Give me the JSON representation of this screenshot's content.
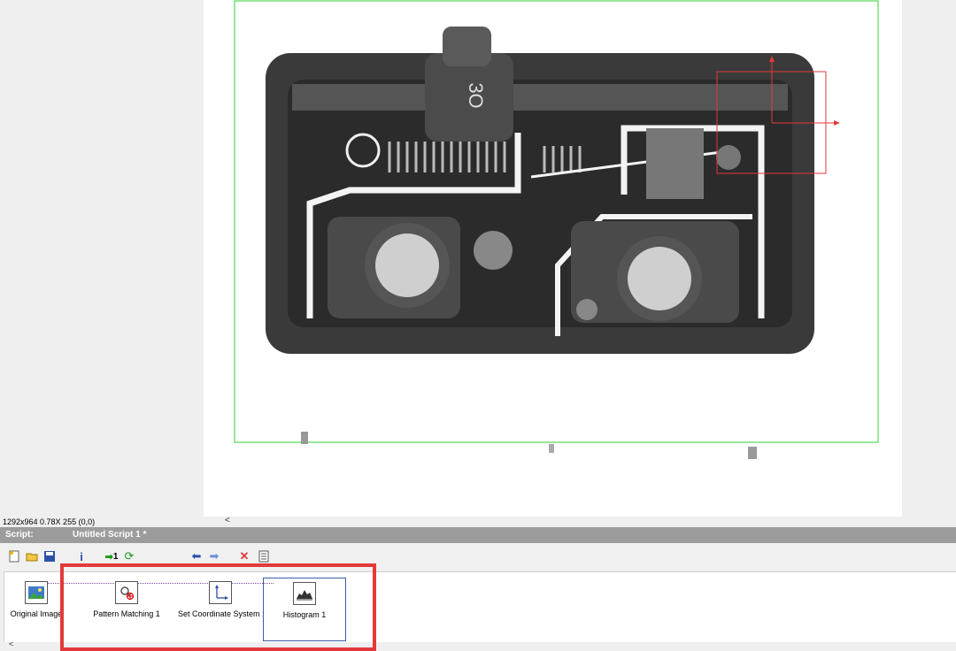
{
  "status_bar": {
    "info": "1292x964 0.78X 255   (0,0)",
    "scroll_glyph": "<"
  },
  "script_panel": {
    "label": "Script:",
    "name": "Untitled Script 1 *"
  },
  "toolbar": {
    "icons": [
      "new-script-icon",
      "open-icon",
      "save-icon",
      "info-icon",
      "run-once-icon",
      "run-continuous-icon",
      "back-arrow-icon",
      "forward-arrow-icon",
      "delete-icon",
      "properties-icon"
    ],
    "run_once_label": "1"
  },
  "steps": [
    {
      "label": "Original Image"
    },
    {
      "label": "Pattern Matching 1"
    },
    {
      "label": "Set Coordinate System :"
    },
    {
      "label": "Histogram 1"
    }
  ],
  "hscroll": {
    "glyph": "<"
  },
  "colors": {
    "roi_outline": "#35d035",
    "annotation": "#e23a3a",
    "selection": "#3a5fa8"
  }
}
